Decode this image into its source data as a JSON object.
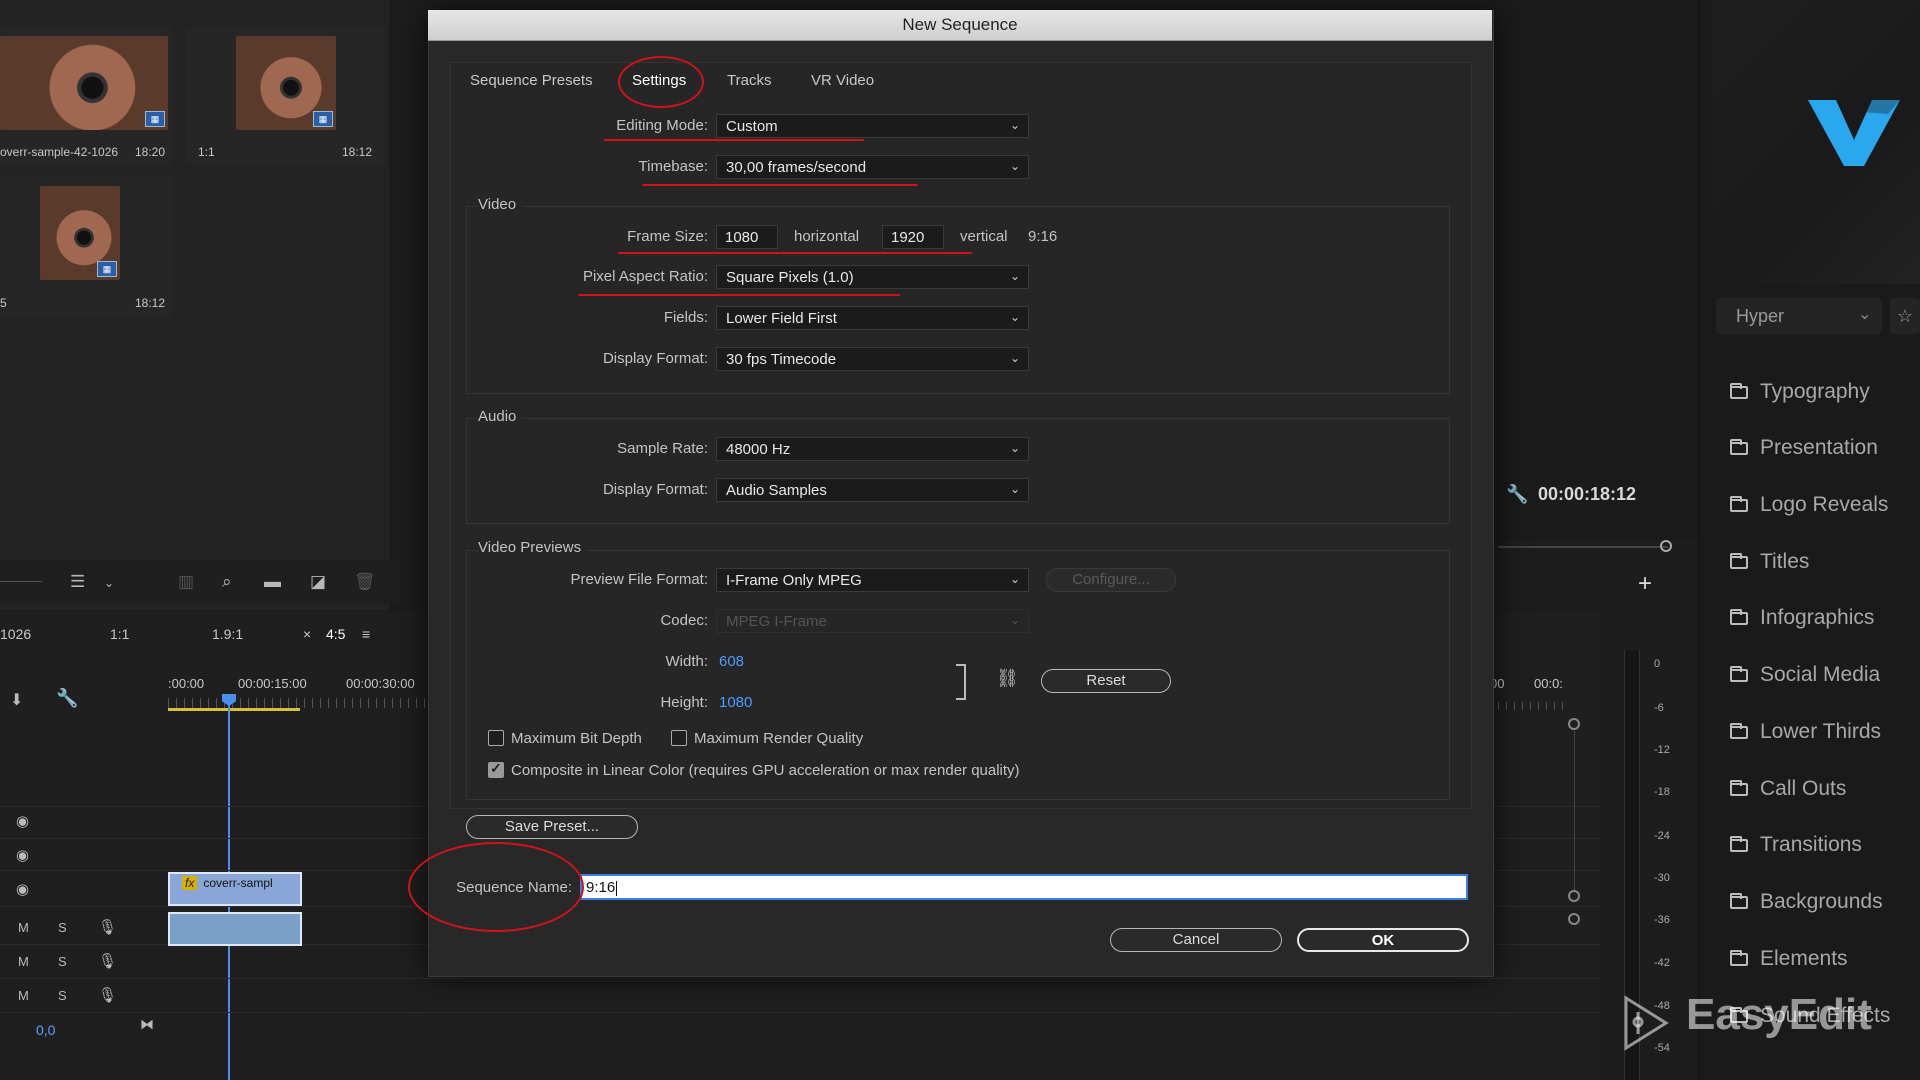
{
  "dialog": {
    "title": "New Sequence",
    "tabs": [
      "Sequence Presets",
      "Settings",
      "Tracks",
      "VR Video"
    ],
    "editing_mode": {
      "label": "Editing Mode:",
      "value": "Custom"
    },
    "timebase": {
      "label": "Timebase:",
      "value": "30,00  frames/second"
    },
    "video": {
      "title": "Video",
      "frame_size_label": "Frame Size:",
      "frame_width": "1080",
      "horizontal_label": "horizontal",
      "frame_height": "1920",
      "vertical_label": "vertical",
      "aspect": "9:16",
      "pixel_aspect_label": "Pixel Aspect Ratio:",
      "pixel_aspect_value": "Square Pixels (1.0)",
      "fields_label": "Fields:",
      "fields_value": "Lower Field First",
      "display_format_label": "Display Format:",
      "display_format_value": "30 fps Timecode"
    },
    "audio": {
      "title": "Audio",
      "sample_rate_label": "Sample Rate:",
      "sample_rate_value": "48000 Hz",
      "display_format_label": "Display Format:",
      "display_format_value": "Audio Samples"
    },
    "previews": {
      "title": "Video Previews",
      "file_format_label": "Preview File Format:",
      "file_format_value": "I-Frame Only MPEG",
      "configure_label": "Configure...",
      "codec_label": "Codec:",
      "codec_value": "MPEG I-Frame",
      "width_label": "Width:",
      "width_value": "608",
      "height_label": "Height:",
      "height_value": "1080",
      "reset_label": "Reset"
    },
    "options": {
      "max_bit_depth": {
        "label": "Maximum Bit Depth",
        "checked": false
      },
      "max_render_quality": {
        "label": "Maximum Render Quality",
        "checked": false
      },
      "linear_color": {
        "label": "Composite in Linear Color (requires GPU acceleration or max render quality)",
        "checked": true
      }
    },
    "save_preset_label": "Save Preset...",
    "sequence_name_label": "Sequence Name:",
    "sequence_name_value": "9:16",
    "cancel_label": "Cancel",
    "ok_label": "OK"
  },
  "project": {
    "items": [
      {
        "name": "overr-sample-42-1026",
        "duration": "18:20"
      },
      {
        "name": "1:1",
        "duration": "18:12"
      },
      {
        "name": "5",
        "duration": "18:12"
      }
    ]
  },
  "timeline": {
    "tabs": [
      "1026",
      "1:1",
      "1.9:1",
      "×",
      "4:5",
      "≡"
    ],
    "ruler": [
      ":00:00",
      "00:00:15:00",
      "00:00:30:00"
    ],
    "clip_label": "coverr-sampl",
    "fx_label": "fx",
    "track_m": "M",
    "track_s": "S",
    "level_value": "0,0",
    "right_ruler": [
      "00",
      "00:0:"
    ],
    "meter_db": [
      "0",
      "-6",
      "-12",
      "-18",
      "-24",
      "-30",
      "-36",
      "-42",
      "-48",
      "-54"
    ]
  },
  "program": {
    "timecode": "00:00:18:12",
    "plus": "+"
  },
  "plugin": {
    "preset_select": "Hyper",
    "star": "☆",
    "categories": [
      "Typography",
      "Presentation",
      "Logo Reveals",
      "Titles",
      "Infographics",
      "Social Media",
      "Lower Thirds",
      "Call Outs",
      "Transitions",
      "Backgrounds",
      "Elements",
      "Sound Effects"
    ]
  },
  "watermark": "EasyEdit",
  "colors": {
    "annotation_red": "#d0121b",
    "accent_blue": "#4d9cff",
    "logo_blue": "#29a8f0"
  }
}
